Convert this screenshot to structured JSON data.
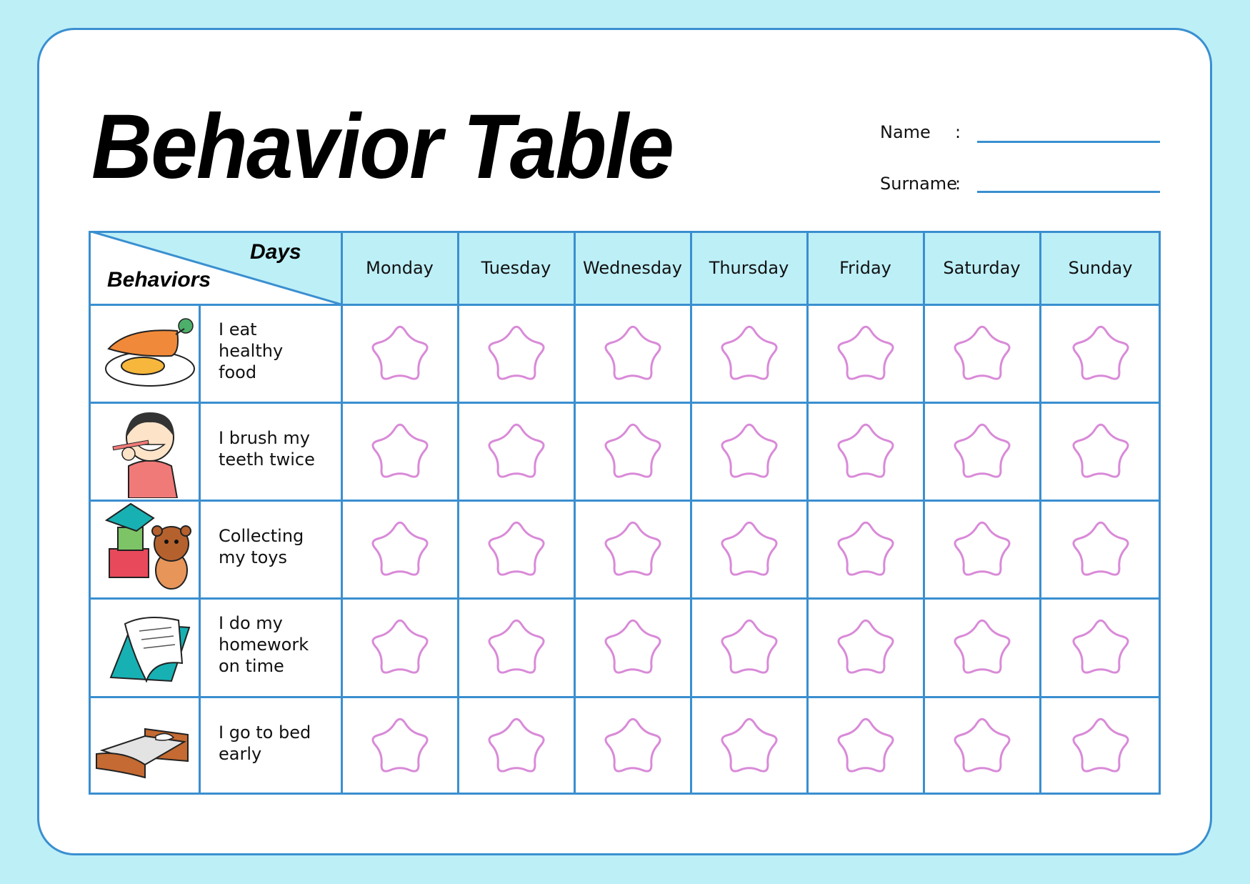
{
  "title": "Behavior Table",
  "fields": [
    {
      "label": "Name",
      "colon": ":",
      "value": ""
    },
    {
      "label": "Surname",
      "colon": ":",
      "value": ""
    }
  ],
  "corner": {
    "top_label": "Days",
    "bottom_label": "Behaviors"
  },
  "days": [
    "Monday",
    "Tuesday",
    "Wednesday",
    "Thursday",
    "Friday",
    "Saturday",
    "Sunday"
  ],
  "behaviors": [
    {
      "icon": "carrot-egg-icon",
      "lines": [
        "I eat",
        "healthy",
        "food"
      ]
    },
    {
      "icon": "boy-brushing-teeth-icon",
      "lines": [
        "I brush my",
        "teeth twice"
      ]
    },
    {
      "icon": "toys-blocks-teddy-bear-icon",
      "lines": [
        "Collecting",
        "my toys"
      ]
    },
    {
      "icon": "homework-books-icon",
      "lines": [
        "I do my",
        "homework",
        "on time"
      ]
    },
    {
      "icon": "bed-icon",
      "lines": [
        "I go to bed",
        "early"
      ]
    }
  ],
  "star_marks": {
    "filled_count": 0,
    "total": 35
  },
  "colors": {
    "background": "#bdeff7",
    "border": "#3a8fd0",
    "header_fill": "#bdeff7",
    "star": "#d98ad8"
  }
}
